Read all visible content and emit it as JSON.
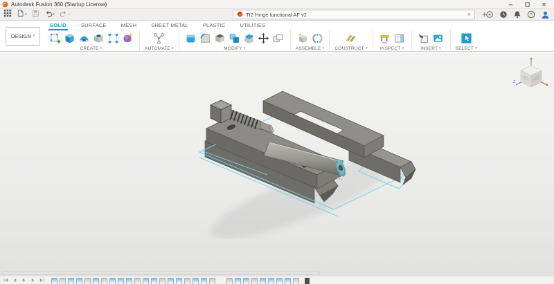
{
  "ui": {
    "caret_down": "▾",
    "close": "×",
    "new_tab": "+"
  },
  "colors": {
    "accent": "#0696d7",
    "selection_cyan": "#2fc4e4",
    "sketch_cyan": "#7ad3e6",
    "body_gray": "#8f8e88",
    "fusion_orange": "#e8661a"
  },
  "window": {
    "title": "Autodesk Fusion 360 (Startup License)",
    "controls": [
      "minimize",
      "maximize",
      "close"
    ]
  },
  "app_bar": {
    "quick_access": [
      {
        "name": "app-grid"
      },
      {
        "name": "file-menu",
        "caret": true
      },
      {
        "name": "save",
        "disabled": true
      },
      {
        "name": "undo",
        "caret": true
      },
      {
        "name": "redo",
        "caret": true,
        "disabled": true
      }
    ],
    "document_tab": {
      "label": "Tf2 Hinge functional AF v2"
    },
    "right_icons": [
      "extensions",
      "job-status",
      "notifications",
      "help",
      "profile"
    ]
  },
  "ribbon": {
    "workspace_selector": {
      "label": "DESIGN"
    },
    "tabs": [
      {
        "label": "SOLID",
        "active": true
      },
      {
        "label": "SURFACE",
        "active": false
      },
      {
        "label": "MESH",
        "active": false
      },
      {
        "label": "SHEET METAL",
        "active": false
      },
      {
        "label": "PLASTIC",
        "active": false
      },
      {
        "label": "UTILITIES",
        "active": false
      }
    ],
    "groups": [
      {
        "label": "CREATE",
        "tools": [
          "create-sketch",
          "extrude",
          "revolve",
          "hole",
          "rectangular-pattern",
          "create-form"
        ]
      },
      {
        "label": "AUTOMATE",
        "tools": [
          "configure"
        ]
      },
      {
        "label": "MODIFY",
        "tools": [
          "press-pull",
          "fillet",
          "shell",
          "combine",
          "split-body",
          "move-copy",
          "align"
        ]
      },
      {
        "label": "ASSEMBLE",
        "tools": [
          "new-component",
          "joint"
        ]
      },
      {
        "label": "CONSTRUCT",
        "tools": [
          "construction-plane"
        ]
      },
      {
        "label": "INSPECT",
        "tools": [
          "measure",
          "section-analysis"
        ]
      },
      {
        "label": "INSERT",
        "tools": [
          "insert-derive",
          "canvas"
        ]
      },
      {
        "label": "SELECT",
        "tools": [
          "select"
        ]
      }
    ]
  },
  "viewport": {
    "viewcube": {
      "visible_axis_label": "Z"
    },
    "model": "hinge-3d-model"
  },
  "timeline": {
    "playback_controls": [
      "go-to-beginning",
      "step-back",
      "play",
      "step-forward",
      "go-to-end"
    ],
    "segments": [
      {
        "icons": [
          "sketch",
          "feature",
          "sketch",
          "sketch",
          "feature",
          "sketch",
          "feature",
          "sketch",
          "sketch",
          "sketch",
          "feature",
          "sketch",
          "sketch",
          "feature",
          "sketch",
          "sketch",
          "feature",
          "sketch",
          "sketch",
          "feature"
        ]
      },
      {
        "icons": [
          "feature",
          "sketch",
          "sketch",
          "feature",
          "sketch",
          "sketch",
          "sketch",
          "sketch",
          "feature"
        ]
      }
    ],
    "marker_icon": "timeline-position-marker"
  }
}
